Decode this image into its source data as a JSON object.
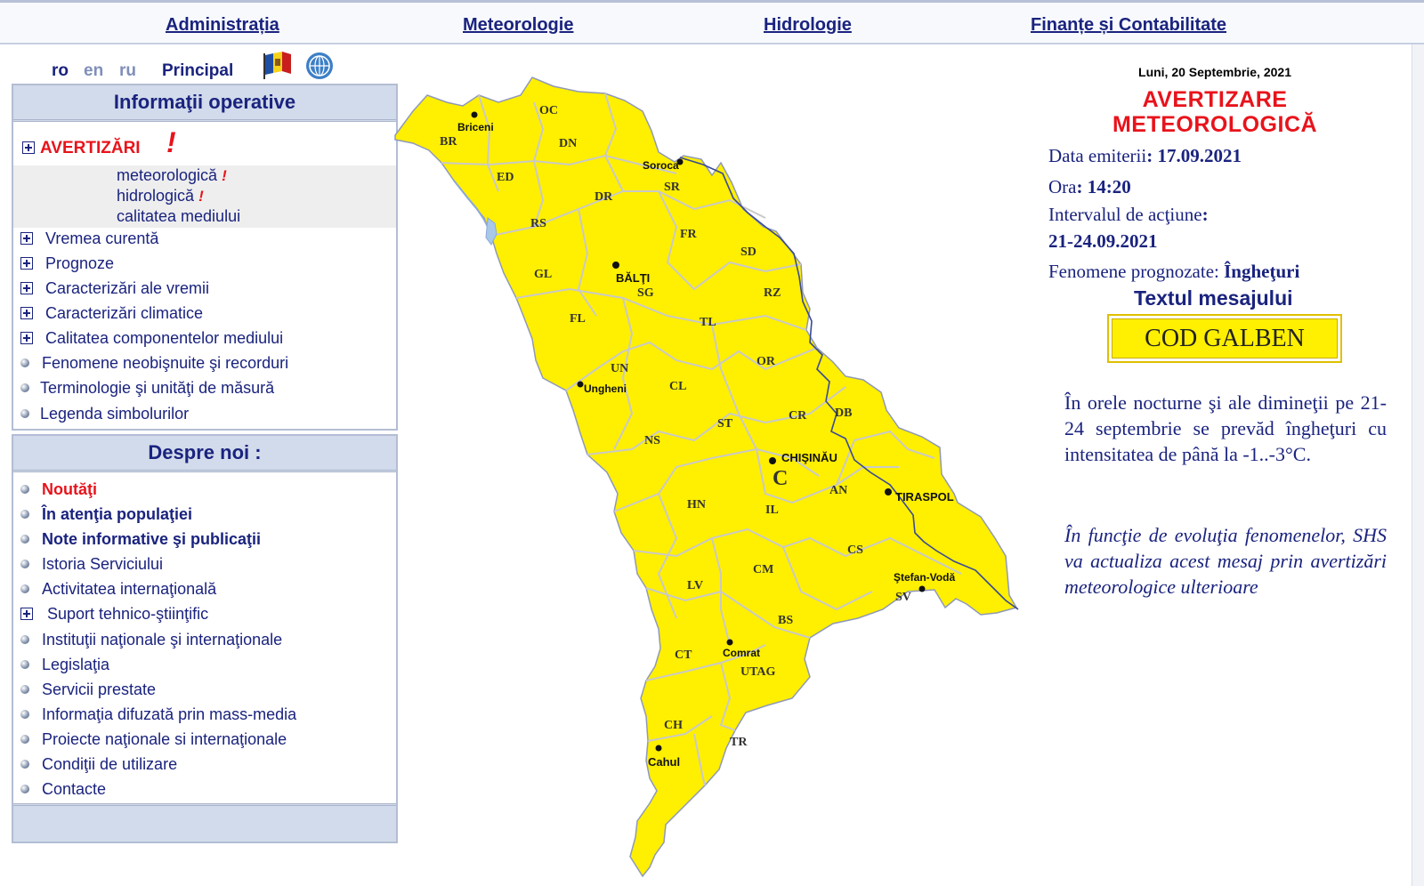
{
  "nav": {
    "items": [
      "Administrația",
      " Meteorologie",
      "Hidrologie",
      "Finanțe și Contabilitate"
    ]
  },
  "lang": {
    "ro": "ro",
    "en": "en",
    "ru": "ru",
    "principal": "Principal"
  },
  "panel1": {
    "title": "Informaţii operative",
    "warnings": "AVERTIZĂRI",
    "warning_sub": [
      "meteorologică",
      "hidrologică",
      "calitatea mediului"
    ],
    "items": [
      "Vremea curentă",
      "Prognoze",
      "Caracterizări ale  vremii",
      "Caracterizări  climatice",
      "Calitatea componentelor mediului",
      "Fenomene neobişnuite şi recorduri",
      "Terminologie şi unităţi de măsură",
      "Legenda simbolurilor"
    ]
  },
  "panel2": {
    "title": "Despre noi :",
    "items": [
      "Noutăţi",
      "În atenţia populaţiei",
      "Note informative şi publicaţii",
      "Istoria Serviciului",
      "Activitatea internaţională",
      "Suport tehnico-ştiinţific",
      "Instituţii naţionale şi internaţionale",
      "Legislaţia",
      "Servicii prestate",
      "Informaţia difuzată prin mass-media",
      "Proiecte naţionale si internaţionale",
      "Condiţii de utilizare",
      "Contacte"
    ]
  },
  "map": {
    "fill_color": "#ffef00",
    "border_color": "#c9c9c9",
    "districts": [
      "OC",
      "BR",
      "DN",
      "ED",
      "DR",
      "SR",
      "RS",
      "FR",
      "SD",
      "GL",
      "SG",
      "RZ",
      "FL",
      "TL",
      "OR",
      "UN",
      "CL",
      "CR",
      "DB",
      "NS",
      "ST",
      "AN",
      "HN",
      "IL",
      "CS",
      "CM",
      "SV",
      "LV",
      "BS",
      "CT",
      "UTAG",
      "CH",
      "TR",
      "C"
    ],
    "cities": [
      "Briceni",
      "Soroca",
      "BĂLŢI",
      "Ungheni",
      "CHIŞINĂU",
      "TIRASPOL",
      "Ştefan-Vodă",
      "Comrat",
      "Cahul"
    ]
  },
  "warning": {
    "date": "Luni, 20 Septembrie, 2021",
    "title_line1": "AVERTIZARE",
    "title_line2": "METEOROLOGICĂ",
    "data_label": "Data emiterii",
    "data_value": ": 17.09.2021",
    "ora_label": "Ora",
    "ora_value": ": 14:20",
    "interval_label": "Intervalul de acţiune",
    "interval_colon": ":",
    "interval_value": "21-24.09.2021",
    "fenomene_label": "Fenomene prognozate: ",
    "fenomene_value": "Îngheţuri",
    "text_heading": "Textul mesajului",
    "code": "COD GALBEN",
    "code_color": "#ffef00",
    "message": "În orele nocturne şi ale dimineţii pe 21-24 septembrie se prevăd îngheţuri cu intensitatea de până la -1..-3°C.",
    "note": "În funcţie de evoluţia fenomenelor, SHS va actualiza acest mesaj prin avertizări meteorologice ulterioare"
  }
}
